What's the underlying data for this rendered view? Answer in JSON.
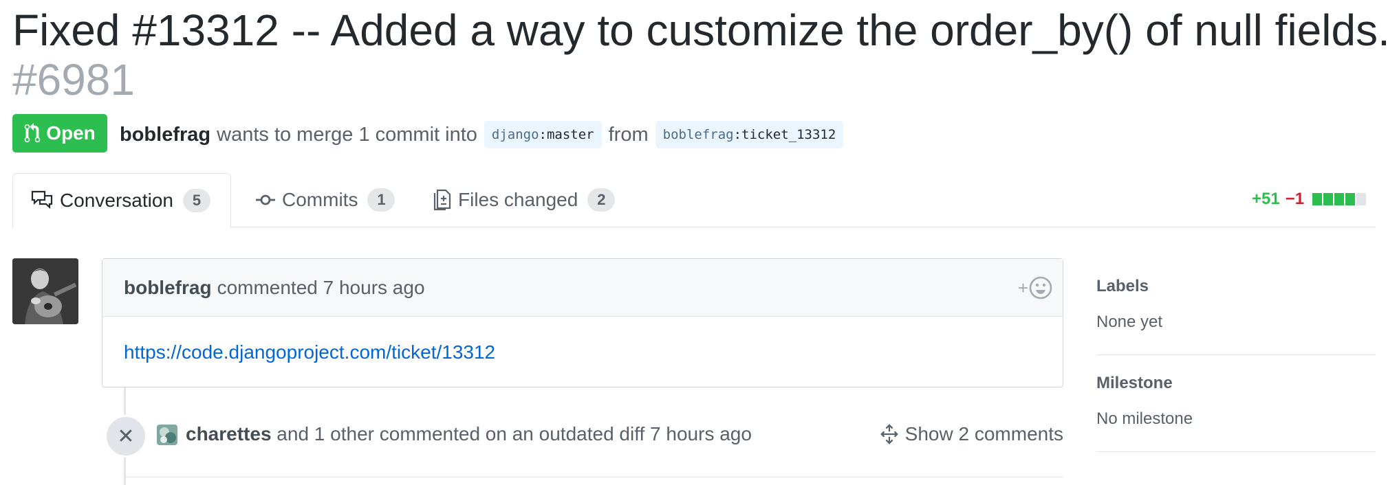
{
  "header": {
    "title": "Fixed #13312 -- Added a way to customize the order_by() of null fields.",
    "number": "#6981",
    "state": "Open",
    "author": "boblefrag",
    "merge_text": "wants to merge 1 commit into",
    "base_repo": "django",
    "base_branch": "master",
    "from_text": "from",
    "head_repo": "boblefrag",
    "head_branch": "ticket_13312"
  },
  "tabs": [
    {
      "label": "Conversation",
      "count": "5",
      "icon": "comment-discussion-icon"
    },
    {
      "label": "Commits",
      "count": "1",
      "icon": "git-commit-icon"
    },
    {
      "label": "Files changed",
      "count": "2",
      "icon": "file-diff-icon"
    }
  ],
  "diffstat": {
    "additions": "+51",
    "deletions": "−1",
    "blocks": [
      "#2cbe4e",
      "#2cbe4e",
      "#2cbe4e",
      "#2cbe4e",
      "#e1e4e8"
    ]
  },
  "comment": {
    "author": "boblefrag",
    "action": "commented 7 hours ago",
    "body_link": "https://code.djangoproject.com/ticket/13312",
    "reaction_icon": "smiley-add-icon"
  },
  "event": {
    "icon": "x-icon",
    "author": "charettes",
    "text": " and 1 other commented on an outdated diff 7 hours ago",
    "show_label": "Show 2 comments"
  },
  "sidebar": {
    "labels_heading": "Labels",
    "labels_value": "None yet",
    "milestone_heading": "Milestone",
    "milestone_value": "No milestone"
  },
  "colors": {
    "open_green": "#2cbe4e",
    "link_blue": "#0366d6",
    "deletion_red": "#cb2431"
  }
}
